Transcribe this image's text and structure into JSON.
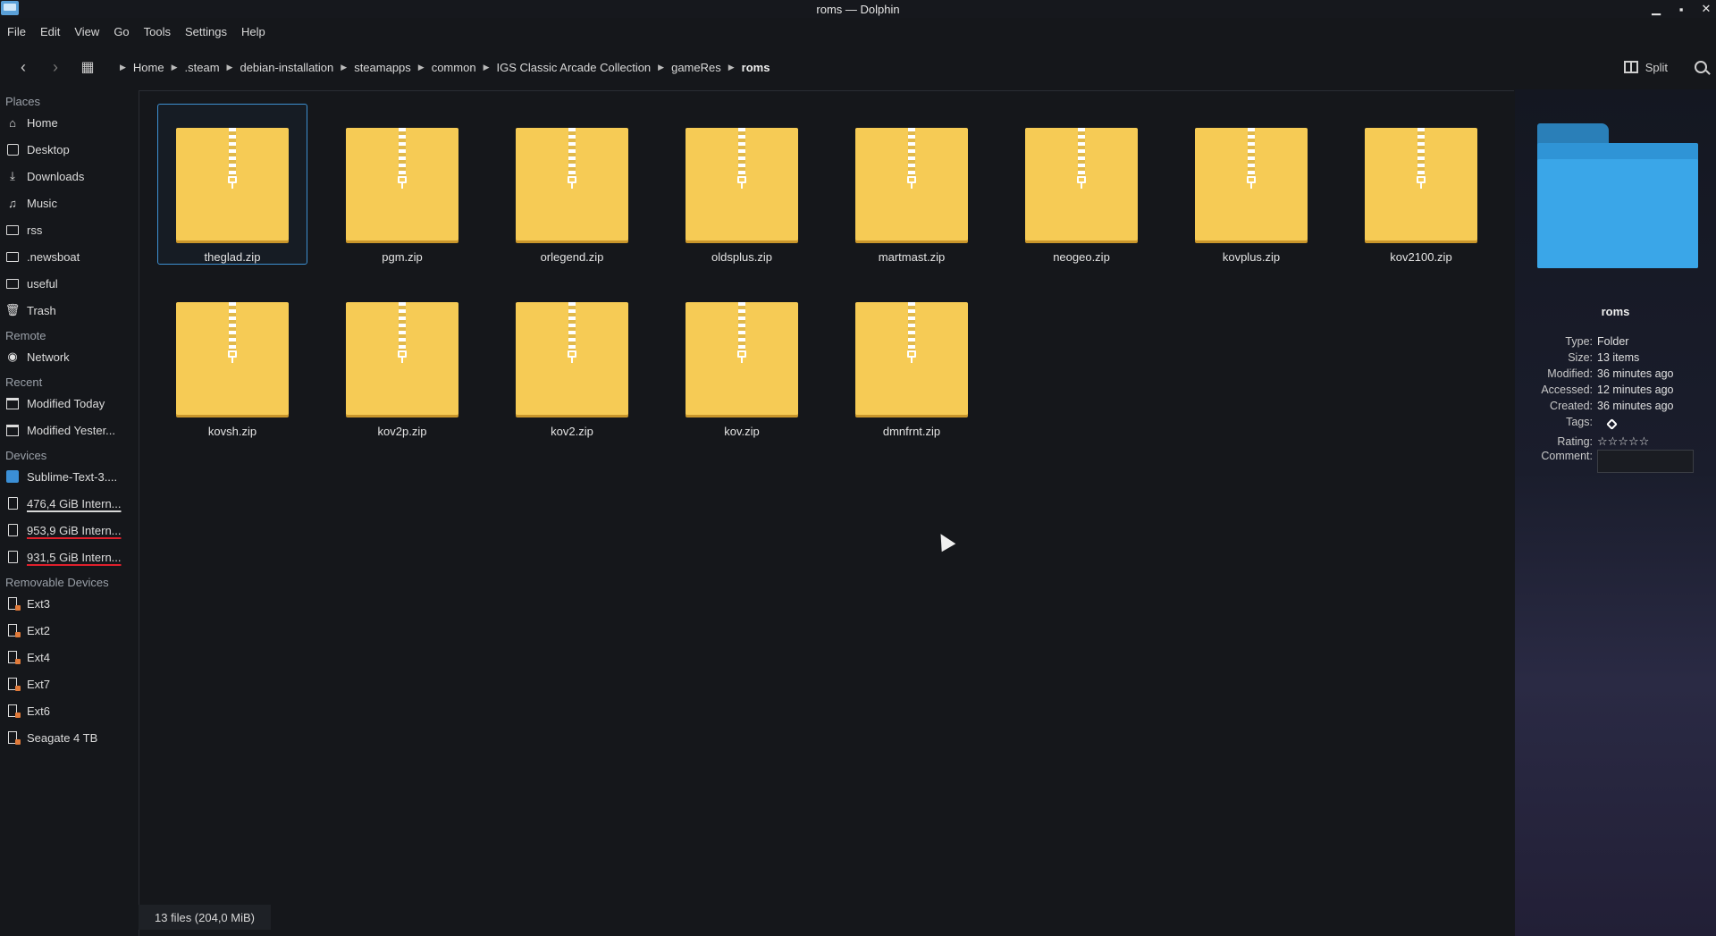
{
  "window": {
    "title": "roms — Dolphin",
    "controls": [
      "▁",
      "▪",
      "✕"
    ]
  },
  "menu": [
    "File",
    "Edit",
    "View",
    "Go",
    "Tools",
    "Settings",
    "Help"
  ],
  "toolbar": {
    "back_icon": "chevron-left-icon",
    "forward_icon": "chevron-right-icon",
    "view_icon": "grid-view-icon",
    "breadcrumbs": [
      "Home",
      ".steam",
      "debian-installation",
      "steamapps",
      "common",
      "IGS Classic Arcade Collection",
      "gameRes",
      "roms"
    ],
    "split_label": "Split"
  },
  "sidebar": {
    "places_header": "Places",
    "places": [
      "Home",
      "Desktop",
      "Downloads",
      "Music",
      "rss",
      ".newsboat",
      "useful",
      "Trash"
    ],
    "remote_header": "Remote",
    "remote": [
      "Network"
    ],
    "recent_header": "Recent",
    "recent": [
      "Modified Today",
      "Modified Yester..."
    ],
    "devices_header": "Devices",
    "devices": [
      "Sublime-Text-3....",
      "476,4 GiB Intern...",
      "953,9 GiB Intern...",
      "931,5 GiB Intern..."
    ],
    "removable_header": "Removable Devices",
    "removable": [
      "Ext3",
      "Ext2",
      "Ext4",
      "Ext7",
      "Ext6",
      "Seagate 4 TB"
    ]
  },
  "files": [
    "theglad.zip",
    "pgm.zip",
    "orlegend.zip",
    "oldsplus.zip",
    "martmast.zip",
    "neogeo.zip",
    "kovplus.zip",
    "kov2100.zip",
    "kovsh.zip",
    "kov2p.zip",
    "kov2.zip",
    "kov.zip",
    "dmnfrnt.zip"
  ],
  "selected_file": "theglad.zip",
  "status": "13 files (204,0 MiB)",
  "info_panel": {
    "name": "roms",
    "type_label": "Type:",
    "type": "Folder",
    "size_label": "Size:",
    "size": "13 items",
    "modified_label": "Modified:",
    "modified": "36 minutes ago",
    "accessed_label": "Accessed:",
    "accessed": "12 minutes ago",
    "created_label": "Created:",
    "created": "36 minutes ago",
    "tags_label": "Tags:",
    "rating_label": "Rating:",
    "rating_stars": "☆☆☆☆☆",
    "comment_label": "Comment:"
  }
}
